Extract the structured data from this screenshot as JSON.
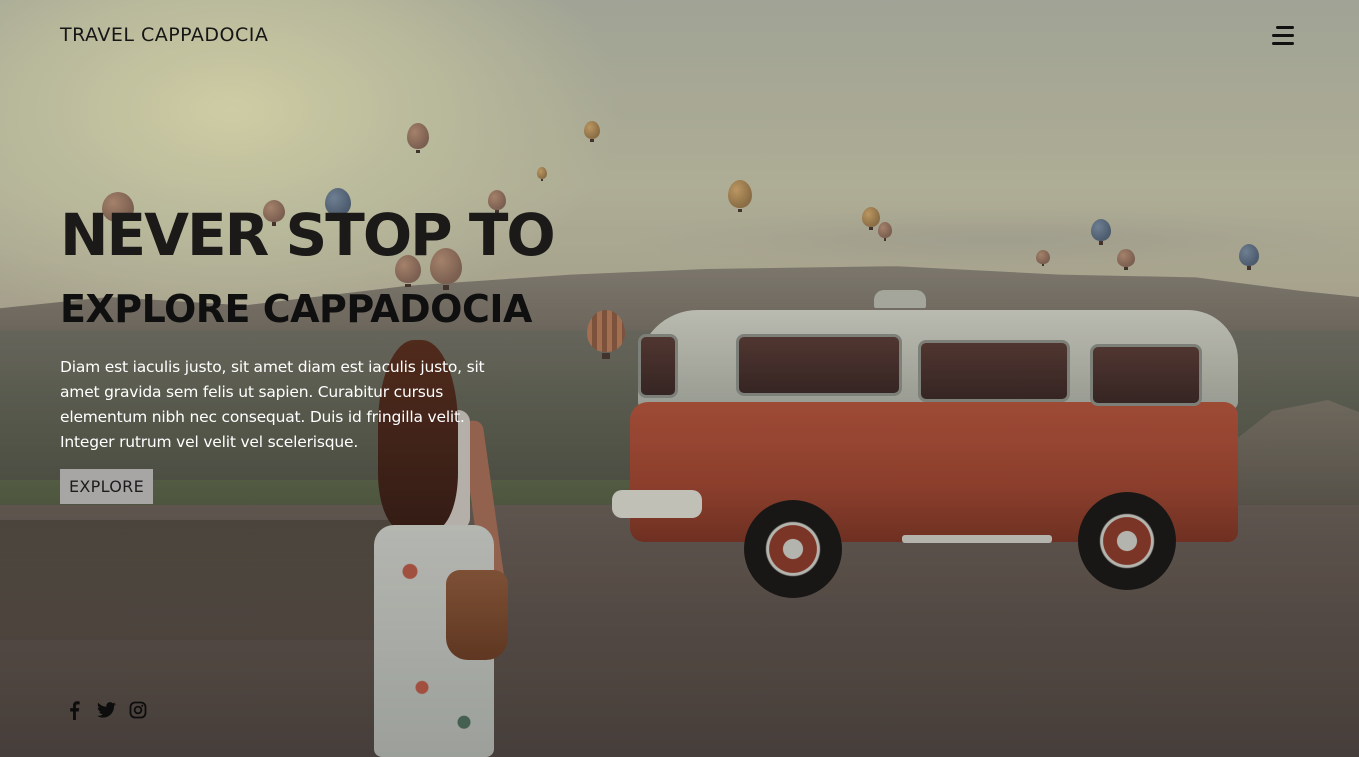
{
  "header": {
    "brand": "TRAVEL CAPPADOCIA",
    "menu_icon": "hamburger-menu-icon"
  },
  "hero": {
    "title": "NEVER STOP TO",
    "subtitle": "EXPLORE CAPPADOCIA",
    "text": "Diam est iaculis justo, sit amet diam est iaculis justo, sit amet gravida sem felis ut sapien. Curabitur cursus elementum nibh nec consequat. Duis id fringilla velit. Integer rutrum vel velit vel scelerisque.",
    "button_label": "EXPLORE"
  },
  "social": {
    "icons": [
      "facebook-icon",
      "twitter-icon",
      "instagram-icon"
    ]
  },
  "colors": {
    "text_dark": "#161616",
    "text_light": "#ffffff",
    "button_bg": "#a7a6a4"
  }
}
